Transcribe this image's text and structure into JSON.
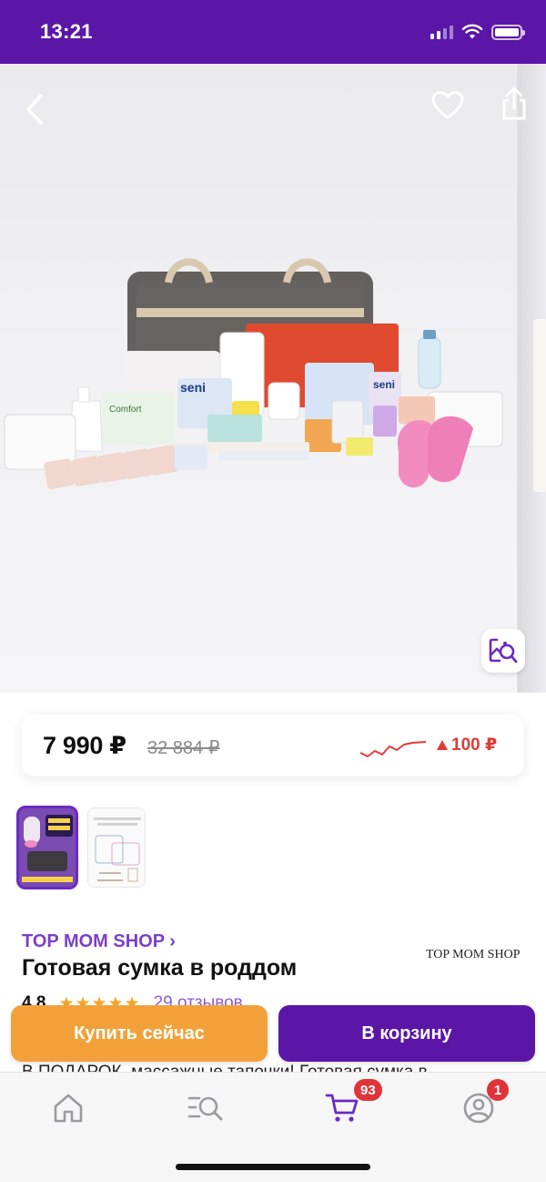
{
  "status_bar": {
    "time": "13:21"
  },
  "product": {
    "price": "7 990 ₽",
    "old_price": "32 884 ₽",
    "price_change": "100 ₽",
    "brand": "TOP MOM SHOP",
    "brand_link_arrow": "›",
    "brand_logo": "TOP MOM SHOP",
    "title": "Готовая сумка в роддом",
    "rating": "4,8",
    "stars": "★★★★★",
    "reviews": "29 отзывов",
    "description": "В ПОДАРОК, массажные тапочки! Готовая сумка в"
  },
  "thumbnails": [
    {
      "label": "thumbnail-1",
      "active": true
    },
    {
      "label": "thumbnail-2",
      "active": false
    }
  ],
  "actions": {
    "buy_now": "Купить сейчас",
    "add_to_cart": "В корзину"
  },
  "tabbar": {
    "cart_badge": "93",
    "profile_badge": "1"
  },
  "colors": {
    "brand": "#5b16a8",
    "buy_now": "#f2a13a",
    "price_up": "#e53935",
    "brand_link": "#7b3fc8"
  },
  "icons": [
    "back-icon",
    "heart-icon",
    "share-icon",
    "image-search-icon",
    "home-icon",
    "catalog-search-icon",
    "cart-icon",
    "profile-icon"
  ]
}
